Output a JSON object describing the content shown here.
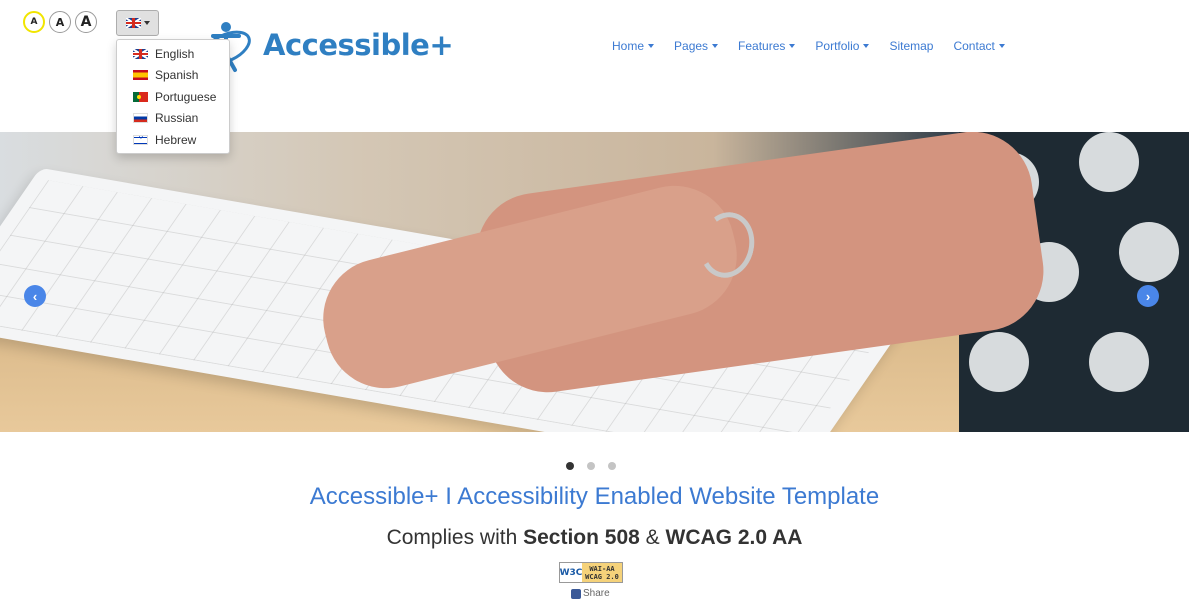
{
  "font_size_controls": [
    {
      "label": "A",
      "size": "small"
    },
    {
      "label": "A",
      "size": "medium"
    },
    {
      "label": "A",
      "size": "large"
    }
  ],
  "language": {
    "selected_flag": "uk-flag-icon",
    "options": [
      {
        "flag": "uk-flag-icon",
        "label": "English"
      },
      {
        "flag": "spain-flag-icon",
        "label": "Spanish"
      },
      {
        "flag": "portugal-flag-icon",
        "label": "Portuguese"
      },
      {
        "flag": "russia-flag-icon",
        "label": "Russian"
      },
      {
        "flag": "israel-flag-icon",
        "label": "Hebrew"
      }
    ]
  },
  "brand": {
    "name": "Accessible+",
    "color": "#2f7fc2"
  },
  "nav": [
    {
      "label": "Home",
      "dropdown": true
    },
    {
      "label": "Pages",
      "dropdown": true
    },
    {
      "label": "Features",
      "dropdown": true
    },
    {
      "label": "Portfolio",
      "dropdown": true
    },
    {
      "label": "Sitemap",
      "dropdown": false
    },
    {
      "label": "Contact",
      "dropdown": true
    }
  ],
  "carousel": {
    "prev_icon": "chevron-left-icon",
    "next_icon": "chevron-right-icon",
    "slide_count": 3,
    "active_slide": 1
  },
  "content": {
    "headline": "Accessible+ I Accessibility Enabled Website Template",
    "sub_prefix": "Complies with ",
    "sub_bold1": "Section 508",
    "sub_mid": " & ",
    "sub_bold2": "WCAG 2.0 AA"
  },
  "badge": {
    "w3c": "W3C",
    "line1": "WAI-AA",
    "line2": "WCAG 2.0"
  },
  "share": {
    "label": "Share"
  },
  "colors": {
    "link": "#3c7ad2",
    "accent": "#4a86e8",
    "highlight": "#f1e500"
  }
}
